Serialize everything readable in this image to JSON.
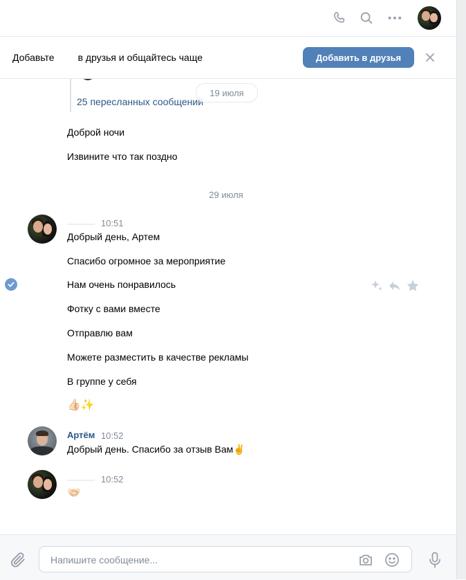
{
  "header": {
    "icons": [
      "phone-icon",
      "search-icon",
      "more-icon"
    ],
    "avatar": "user-avatar"
  },
  "banner": {
    "text_start": "Добавьте",
    "text_end": "в друзья и общайтесь чаще",
    "add_button": "Добавить в друзья",
    "close_icon": "close-icon"
  },
  "forwarded": {
    "link": "25 пересланных сообщений",
    "date_pill": "19 июля"
  },
  "messages_before": [
    "Доброй ночи",
    "Извините что так поздно"
  ],
  "date_separator": "29 июля",
  "group1": {
    "time": "10:51",
    "messages": [
      "Добрый день, Артем",
      "Спасибо огромное за мероприятие",
      "Нам очень понравилось",
      "Фотку с вами вместе",
      "Отправлю вам",
      "Можете разместить в качестве рекламы",
      "В группе у себя",
      "👍🏻✨"
    ]
  },
  "group2": {
    "author": "Артём",
    "time": "10:52",
    "message": "Добрый день. Спасибо за отзыв Вам✌️"
  },
  "group3": {
    "time": "10:52",
    "message": "🤝🏻"
  },
  "composer": {
    "placeholder": "Напишите сообщение..."
  },
  "colors": {
    "accent": "#5181b8",
    "link": "#2a5885",
    "muted": "#818c99"
  }
}
